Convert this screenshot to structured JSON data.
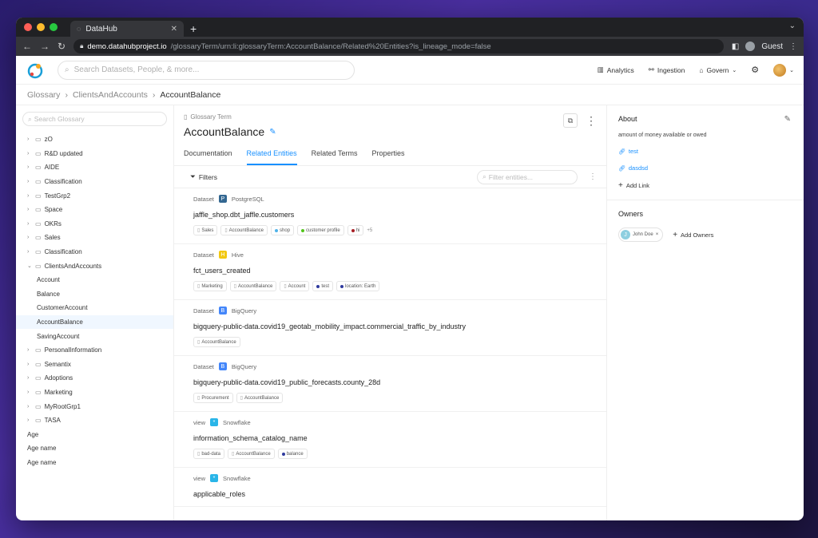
{
  "browser": {
    "tab_title": "DataHub",
    "new_tab": "+",
    "url_host": "demo.datahubproject.io",
    "url_path": "/glossaryTerm/urn:li:glossaryTerm:AccountBalance/Related%20Entities?is_lineage_mode=false",
    "profile": "Guest"
  },
  "header": {
    "search_placeholder": "Search Datasets, People, & more...",
    "analytics": "Analytics",
    "ingestion": "Ingestion",
    "govern": "Govern"
  },
  "breadcrumb": {
    "root": "Glossary",
    "parent": "ClientsAndAccounts",
    "current": "AccountBalance"
  },
  "sidebar": {
    "search_placeholder": "Search Glossary",
    "groups_top": [
      {
        "label": "zO"
      },
      {
        "label": "R&D updated"
      },
      {
        "label": "AIDE"
      },
      {
        "label": "Classification"
      },
      {
        "label": "TestGrp2"
      },
      {
        "label": "Space"
      },
      {
        "label": "OKRs"
      },
      {
        "label": "Sales"
      },
      {
        "label": "Classification"
      },
      {
        "label": "ClientsAndAccounts"
      }
    ],
    "children": [
      {
        "label": "Account"
      },
      {
        "label": "Balance"
      },
      {
        "label": "CustomerAccount"
      },
      {
        "label": "AccountBalance"
      },
      {
        "label": "SavingAccount"
      }
    ],
    "groups_bottom": [
      {
        "label": "PersonalInformation"
      },
      {
        "label": "Semantix"
      },
      {
        "label": "Adoptions"
      },
      {
        "label": "Marketing"
      },
      {
        "label": "MyRootGrp1"
      },
      {
        "label": "TASA"
      }
    ],
    "terms": [
      {
        "label": "Age"
      },
      {
        "label": "Age name"
      },
      {
        "label": "Age name"
      }
    ]
  },
  "term": {
    "type_label": "Glossary Term",
    "name": "AccountBalance"
  },
  "tabs": [
    "Documentation",
    "Related Entities",
    "Related Terms",
    "Properties"
  ],
  "filters": {
    "label": "Filters",
    "placeholder": "Filter entities..."
  },
  "entities": [
    {
      "type": "Dataset",
      "platform": "PostgreSQL",
      "platform_color": "#336791",
      "platform_glyph": "P",
      "name": "jaffle_shop.dbt_jaffle.customers",
      "tags": [
        {
          "label": "Sales",
          "kind": "term"
        },
        {
          "label": "AccountBalance",
          "kind": "term"
        },
        {
          "label": "shop",
          "kind": "tag",
          "color": "#4fb3e8"
        },
        {
          "label": "customer profile",
          "kind": "tag",
          "color": "#52c41a"
        },
        {
          "label": "hi",
          "kind": "tag",
          "color": "#a61d24"
        }
      ],
      "more": "+5"
    },
    {
      "type": "Dataset",
      "platform": "Hive",
      "platform_color": "#f2c811",
      "platform_glyph": "H",
      "name": "fct_users_created",
      "tags": [
        {
          "label": "Marketing",
          "kind": "term"
        },
        {
          "label": "AccountBalance",
          "kind": "term"
        },
        {
          "label": "Account",
          "kind": "term"
        },
        {
          "label": "test",
          "kind": "tag",
          "color": "#2f3a9e"
        },
        {
          "label": "location: Earth",
          "kind": "tag",
          "color": "#2f3a9e"
        }
      ],
      "more": ""
    },
    {
      "type": "Dataset",
      "platform": "BigQuery",
      "platform_color": "#4386fa",
      "platform_glyph": "B",
      "name": "bigquery-public-data.covid19_geotab_mobility_impact.commercial_traffic_by_industry",
      "tags": [
        {
          "label": "AccountBalance",
          "kind": "term"
        }
      ],
      "more": ""
    },
    {
      "type": "Dataset",
      "platform": "BigQuery",
      "platform_color": "#4386fa",
      "platform_glyph": "B",
      "name": "bigquery-public-data.covid19_public_forecasts.county_28d",
      "tags": [
        {
          "label": "Procurement",
          "kind": "term"
        },
        {
          "label": "AccountBalance",
          "kind": "term"
        }
      ],
      "more": ""
    },
    {
      "type": "view",
      "platform": "Snowflake",
      "platform_color": "#29b5e8",
      "platform_glyph": "*",
      "name": "information_schema_catalog_name",
      "tags": [
        {
          "label": "bad-data",
          "kind": "term"
        },
        {
          "label": "AccountBalance",
          "kind": "term"
        },
        {
          "label": "balance",
          "kind": "tag",
          "color": "#2f3a9e"
        }
      ],
      "more": ""
    },
    {
      "type": "view",
      "platform": "Snowflake",
      "platform_color": "#29b5e8",
      "platform_glyph": "*",
      "name": "applicable_roles",
      "tags": [],
      "more": ""
    }
  ],
  "about": {
    "title": "About",
    "description": "amount of money available or owed",
    "links": [
      "test",
      "dasdsd"
    ],
    "add_link": "Add Link"
  },
  "owners": {
    "title": "Owners",
    "owner_name": "John Doe",
    "owner_initial": "J",
    "add_owners": "Add Owners"
  }
}
